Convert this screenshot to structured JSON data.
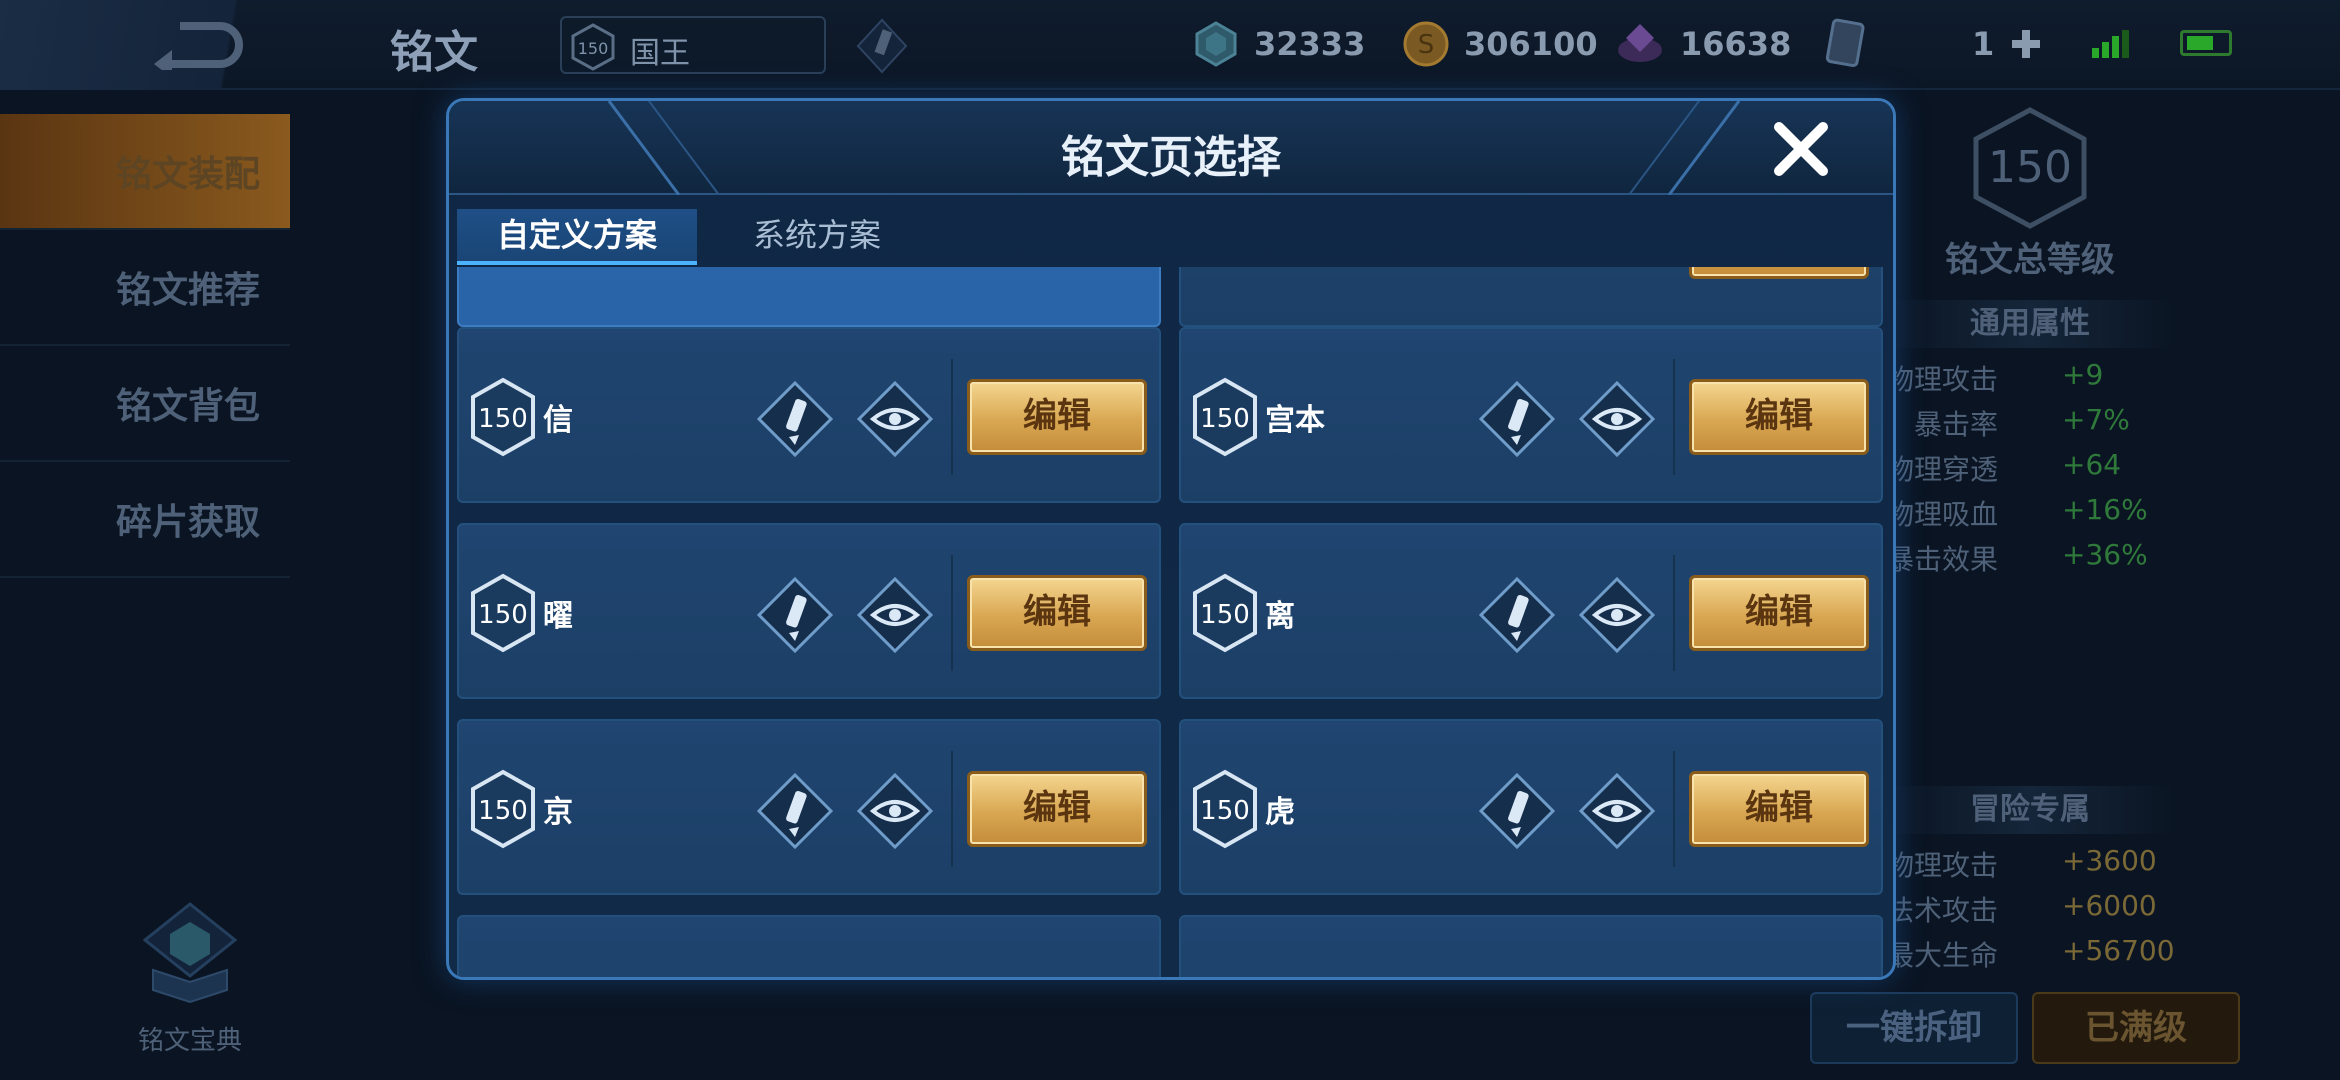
{
  "topbar": {
    "title": "铭文",
    "level": "150",
    "player_name": "国王",
    "currencies": [
      {
        "name": "diamond",
        "icon": "diamond-icon",
        "value": "32333"
      },
      {
        "name": "gold",
        "icon": "gold-coin-icon",
        "value": "306100"
      },
      {
        "name": "crystal",
        "icon": "crystal-icon",
        "value": "16638"
      },
      {
        "name": "card",
        "icon": "card-icon",
        "value": "1"
      }
    ]
  },
  "sidebar": {
    "items": [
      {
        "label": "铭文装配",
        "active": true
      },
      {
        "label": "铭文推荐",
        "active": false
      },
      {
        "label": "铭文背包",
        "active": false
      },
      {
        "label": "碎片获取",
        "active": false
      }
    ],
    "codex_label": "铭文宝典"
  },
  "right_panel": {
    "total_level": "150",
    "total_level_label": "铭文总等级",
    "general_title": "通用属性",
    "general_attrs": [
      {
        "k": "物理攻击",
        "v": "+9"
      },
      {
        "k": "暴击率",
        "v": "+7%"
      },
      {
        "k": "物理穿透",
        "v": "+64"
      },
      {
        "k": "物理吸血",
        "v": "+16%"
      },
      {
        "k": "暴击效果",
        "v": "+36%"
      }
    ],
    "adventure_title": "冒险专属",
    "adventure_attrs": [
      {
        "k": "物理攻击",
        "v": "+3600"
      },
      {
        "k": "法术攻击",
        "v": "+6000"
      },
      {
        "k": "最大生命",
        "v": "+56700"
      }
    ],
    "dismantle_label": "一键拆卸",
    "maxed_label": "已满级"
  },
  "modal": {
    "title": "铭文页选择",
    "tabs": [
      {
        "label": "自定义方案",
        "active": true
      },
      {
        "label": "系统方案",
        "active": false
      }
    ],
    "edit_label": "编辑",
    "pages": [
      {
        "level": "150",
        "name": "信"
      },
      {
        "level": "150",
        "name": "宫本"
      },
      {
        "level": "150",
        "name": "曜"
      },
      {
        "level": "150",
        "name": "离"
      },
      {
        "level": "150",
        "name": "京"
      },
      {
        "level": "150",
        "name": "虎"
      }
    ]
  },
  "colors": {
    "accent_blue": "#3a78b8",
    "edit_gold": "#d9a752",
    "positive_green": "#2f7a3a"
  }
}
